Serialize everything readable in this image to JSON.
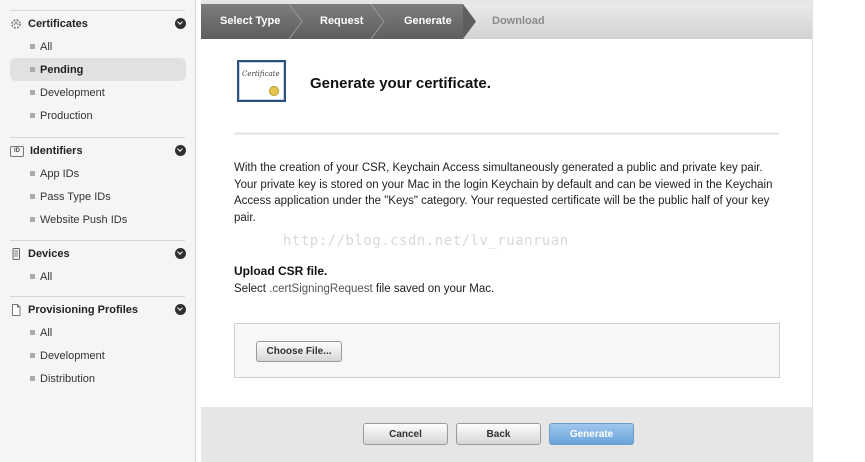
{
  "sidebar": {
    "sections": [
      {
        "title": "Certificates",
        "icon": "certificate-gear-icon",
        "items": [
          "All",
          "Pending",
          "Development",
          "Production"
        ],
        "active": "Pending"
      },
      {
        "title": "Identifiers",
        "icon": "id-icon",
        "icon_text": "ID",
        "items": [
          "App IDs",
          "Pass Type IDs",
          "Website Push IDs"
        ]
      },
      {
        "title": "Devices",
        "icon": "device-icon",
        "items": [
          "All"
        ]
      },
      {
        "title": "Provisioning Profiles",
        "icon": "document-icon",
        "items": [
          "All",
          "Development",
          "Distribution"
        ]
      }
    ]
  },
  "steps": [
    "Select Type",
    "Request",
    "Generate",
    "Download"
  ],
  "current_step": "Generate",
  "content": {
    "heading": "Generate your certificate.",
    "cert_icon_text": "Certificate",
    "paragraph": "With the creation of your CSR, Keychain Access simultaneously generated a public and private key pair. Your private key is stored on your Mac in the login Keychain by default and can be viewed in the Keychain Access application under the \"Keys\" category. Your requested certificate will be the public half of your key pair.",
    "watermark": "http://blog.csdn.net/lv_ruanruan",
    "upload_title": "Upload CSR file.",
    "upload_desc_prefix": "Select ",
    "upload_desc_ext": ".certSigningRequest",
    "upload_desc_suffix": " file saved on your Mac.",
    "choose_file_label": "Choose File..."
  },
  "footer": {
    "cancel_label": "Cancel",
    "back_label": "Back",
    "generate_label": "Generate"
  },
  "colors": {
    "primary_button": "#7fb2e5",
    "stepbar_active": "#6b6b6b",
    "cert_border": "#2b4f7f"
  }
}
